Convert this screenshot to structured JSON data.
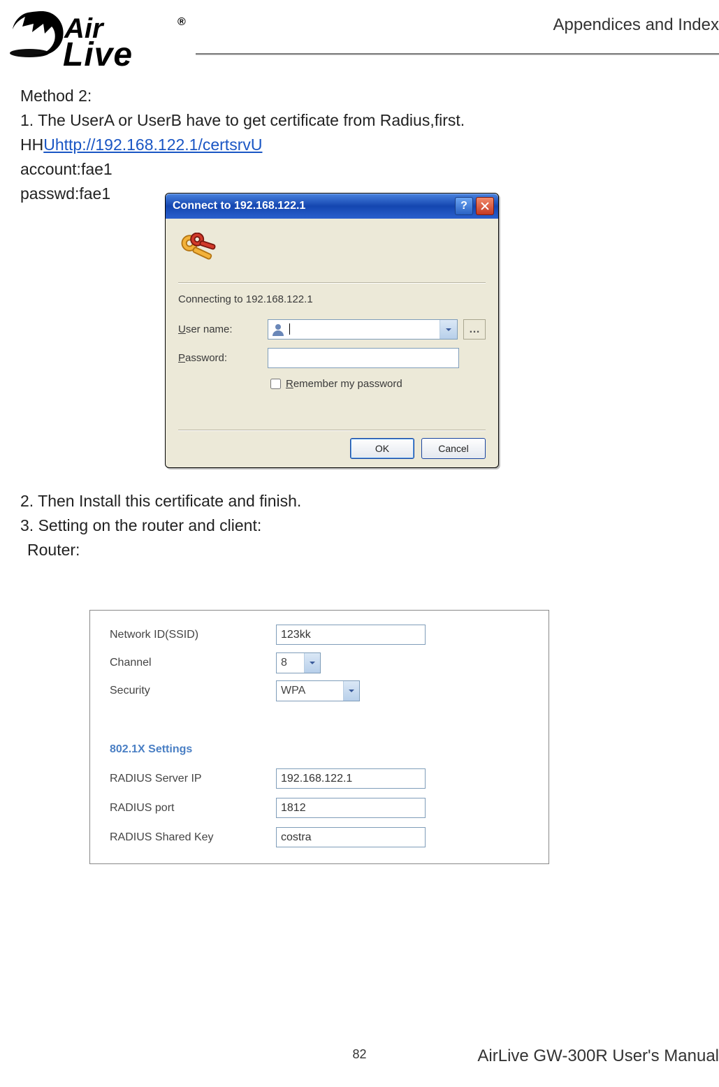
{
  "header": {
    "section": "Appendices and Index"
  },
  "logo": {
    "brand_top": "Air",
    "brand_bottom": "Live",
    "mark": "®"
  },
  "text": {
    "method_title": "Method 2:",
    "step1": "1. The UserA or UserB have to get certificate from Radius,first.",
    "url_prefix": "HH",
    "url_link": "Uhttp://192.168.122.1/certsrvU",
    "account": "account:fae1",
    "passwd": "passwd:fae1",
    "step2": "2. Then Install this certificate and finish.",
    "step3": "3. Setting on the router and client:",
    "router_label": "Router:"
  },
  "dialog": {
    "title": "Connect to 192.168.122.1",
    "message": "Connecting to 192.168.122.1",
    "username_label_pre": "U",
    "username_label_post": "ser name:",
    "password_label_pre": "P",
    "password_label_post": "assword:",
    "remember_pre": "R",
    "remember_post": "emember my password",
    "btn_ok": "OK",
    "btn_cancel": "Cancel",
    "username_value": "",
    "password_value": ""
  },
  "router": {
    "ssid_label": "Network ID(SSID)",
    "ssid_value": "123kk",
    "channel_label": "Channel",
    "channel_value": "8",
    "security_label": "Security",
    "security_value": "WPA",
    "section": "802.1X Settings",
    "radius_ip_label": "RADIUS Server IP",
    "radius_ip_value": "192.168.122.1",
    "radius_port_label": "RADIUS port",
    "radius_port_value": "1812",
    "radius_key_label": "RADIUS Shared Key",
    "radius_key_value": "costra"
  },
  "footer": {
    "page_number": "82",
    "manual": "AirLive GW-300R User's Manual"
  }
}
